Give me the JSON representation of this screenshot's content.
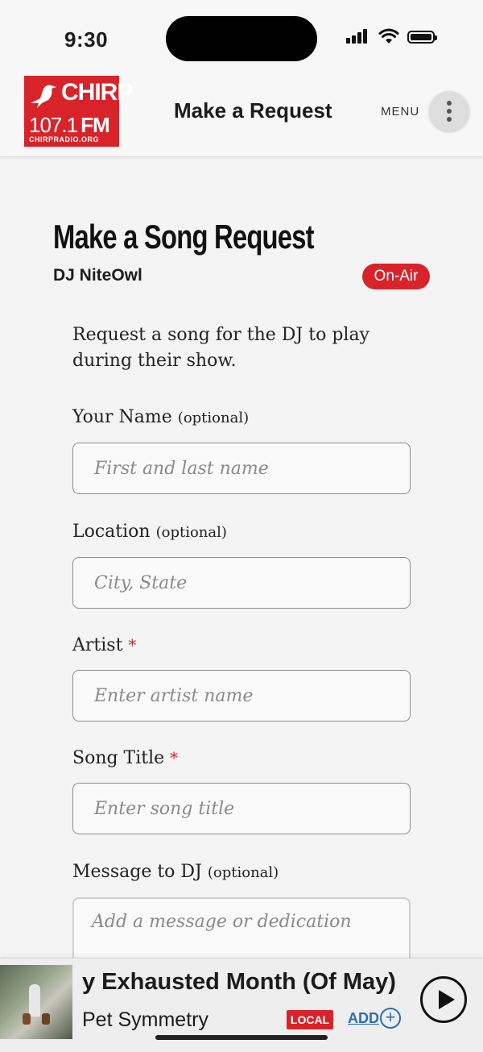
{
  "status_bar": {
    "time": "9:30"
  },
  "header": {
    "logo": {
      "name": "CHIRP",
      "frequency": "107.1",
      "band": "FM",
      "url": "CHIRPRADIO.ORG"
    },
    "title": "Make a Request",
    "menu_label": "MENU"
  },
  "content": {
    "heading": "Make a Song Request",
    "dj_name": "DJ NiteOwl",
    "status_badge": "On-Air",
    "intro": "Request a song for the DJ to play during their show.",
    "fields": {
      "name": {
        "label": "Your Name",
        "optional": "(optional)",
        "placeholder": "First and last name"
      },
      "location": {
        "label": "Location",
        "optional": "(optional)",
        "placeholder": "City, State"
      },
      "artist": {
        "label": "Artist",
        "required": "*",
        "placeholder": "Enter artist name"
      },
      "song_title": {
        "label": "Song Title",
        "required": "*",
        "placeholder": "Enter song title"
      },
      "message": {
        "label": "Message to DJ",
        "optional": "(optional)",
        "placeholder": "Add a message or dedication"
      }
    }
  },
  "player": {
    "song": "y Exhausted Month (Of May)",
    "artist": "Pet Symmetry",
    "local_badge": "LOCAL",
    "add_label": "ADD",
    "add_icon": "+",
    "accent_color": "#d8232a",
    "link_color": "#2a6fb5"
  }
}
